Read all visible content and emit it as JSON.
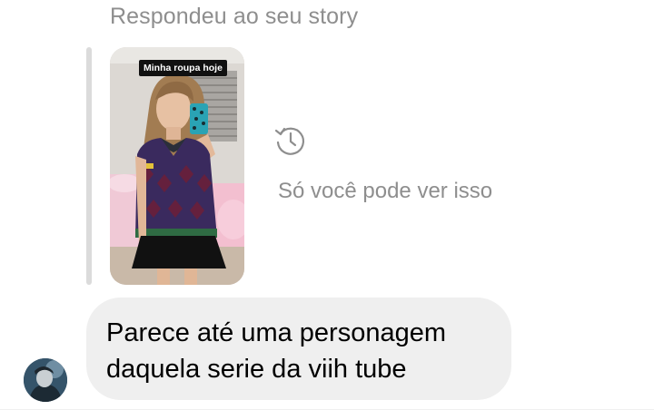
{
  "reply": {
    "header": "Respondeu ao seu story",
    "story": {
      "caption": "Minha roupa hoje"
    },
    "private_note": "Só você pode ver isso",
    "history_icon": "history-icon"
  },
  "message": {
    "lines": [
      "Parece até uma personagem",
      "daquela serie da viih tube"
    ],
    "bubble_color": "#efefef"
  },
  "sender": {
    "avatar_icon": "avatar"
  },
  "colors": {
    "muted_text": "#8e8e8e",
    "quote_bar": "#dbdbdb"
  }
}
